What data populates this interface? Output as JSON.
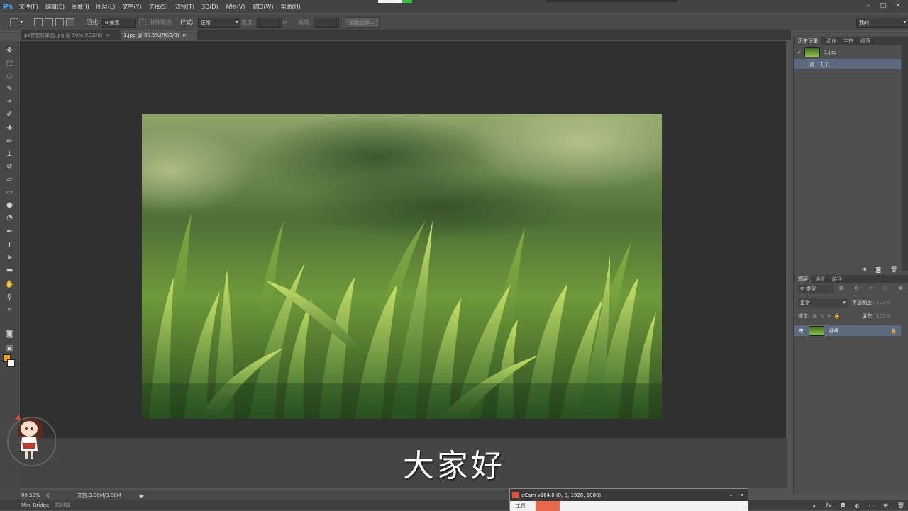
{
  "menubar": {
    "logo": "Ps",
    "items": [
      "文件(F)",
      "编辑(E)",
      "图像(I)",
      "图层(L)",
      "文字(Y)",
      "选择(S)",
      "滤镜(T)",
      "3D(D)",
      "视图(V)",
      "窗口(W)",
      "帮助(H)"
    ],
    "controls": [
      "–",
      "□",
      "✕"
    ]
  },
  "options": {
    "feather_label": "羽化:",
    "feather_value": "0 像素",
    "antialias_label": "消除锯齿",
    "style_label": "样式:",
    "style_value": "正常",
    "width_label": "宽度:",
    "height_label": "高度:",
    "refine_edge": "调整边缘...",
    "workspace": "我的"
  },
  "tabs": [
    {
      "label": "ps梦想效果图.jpg @ 50%(RGB/8)",
      "active": false
    },
    {
      "label": "1.jpg @ 80.5%(RGB/8)",
      "active": true
    }
  ],
  "history_panel": {
    "tabs": [
      "历史记录",
      "动作",
      "字符",
      "段落"
    ],
    "snapshot": "1.jpg",
    "step": "打开"
  },
  "layers_panel": {
    "tabs": [
      "图层",
      "通道",
      "路径"
    ],
    "filter": "类型",
    "blend_mode": "正常",
    "opacity_label": "不透明度:",
    "opacity_value": "100%",
    "lock_label": "锁定:",
    "fill_label": "填充:",
    "fill_value": "100%",
    "layer_name": "背景"
  },
  "subtitle": "大家好",
  "status": {
    "zoom": "80.53%",
    "doc": "文档:3.00M/3.00M"
  },
  "bottom": {
    "mini_bridge": "Mini Bridge",
    "timeline": "时间轴"
  },
  "ocam": {
    "title": "oCam v264.0 (0, 0, 1920, 1080)",
    "tool_label": "工具"
  },
  "colors": {
    "foreground": "#f0a21a",
    "background": "#ffffff",
    "accent": "#4ba3f0"
  }
}
